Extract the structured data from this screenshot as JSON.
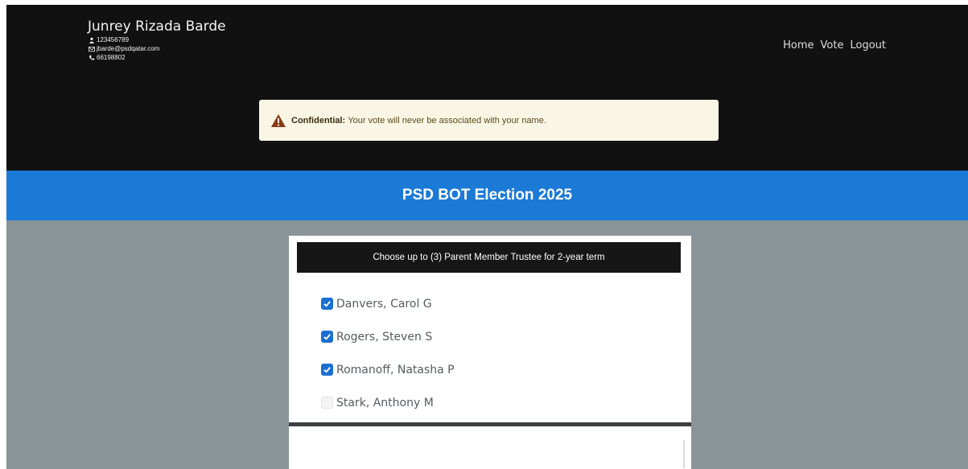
{
  "user": {
    "name": "Junrey Rizada Barde",
    "id": "123456789",
    "email": "jbarde@psdqatar.com",
    "phone": "66198802"
  },
  "nav": {
    "home": "Home",
    "vote": "Vote",
    "logout": "Logout"
  },
  "notice": {
    "label": "Confidential:",
    "text": "Your vote will never be associated with your name."
  },
  "title": "PSD BOT Election 2025",
  "ballot": {
    "heading": "Choose up to (3) Parent Member Trustee for 2-year term",
    "candidates": [
      {
        "name": "Danvers, Carol G",
        "checked": true
      },
      {
        "name": "Rogers, Steven S",
        "checked": true
      },
      {
        "name": "Romanoff, Natasha P",
        "checked": true
      },
      {
        "name": "Stark, Anthony M",
        "checked": false
      }
    ]
  },
  "colors": {
    "header_bg": "#111111",
    "title_bar": "#1b7ad6",
    "page_bg": "#8a9398",
    "checkbox_on": "#1a6fd1",
    "notice_bg": "#faf6e6"
  }
}
